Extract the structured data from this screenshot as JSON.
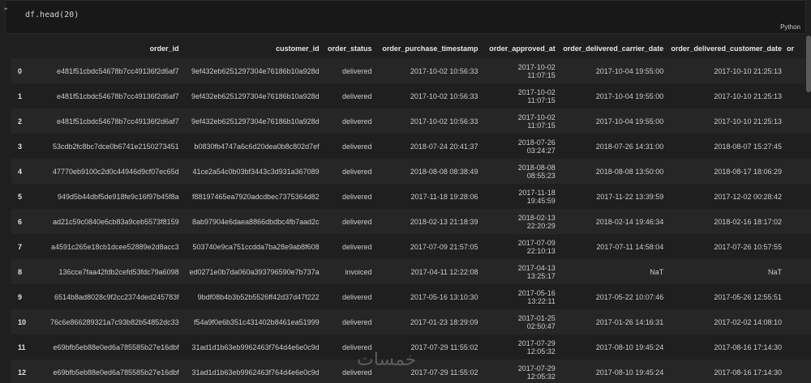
{
  "cell": {
    "code": "df.head(20)",
    "language": "Python",
    "chevron": "⌄"
  },
  "table": {
    "columns": [
      "order_id",
      "customer_id",
      "order_status",
      "order_purchase_timestamp",
      "order_approved_at",
      "order_delivered_carrier_date",
      "order_delivered_customer_date",
      "or"
    ],
    "rows": [
      {
        "idx": "0",
        "order_id": "e481f51cbdc54678b7cc49136f2d6af7",
        "customer_id": "9ef432eb6251297304e76186b10a928d",
        "status": "delivered",
        "purchase": "2017-10-02 10:56:33",
        "approved_date": "2017-10-02",
        "approved_time": "11:07:15",
        "carrier": "2017-10-04 19:55:00",
        "customer": "2017-10-10 21:25:13"
      },
      {
        "idx": "1",
        "order_id": "e481f51cbdc54678b7cc49136f2d6af7",
        "customer_id": "9ef432eb6251297304e76186b10a928d",
        "status": "delivered",
        "purchase": "2017-10-02 10:56:33",
        "approved_date": "2017-10-02",
        "approved_time": "11:07:15",
        "carrier": "2017-10-04 19:55:00",
        "customer": "2017-10-10 21:25:13"
      },
      {
        "idx": "2",
        "order_id": "e481f51cbdc54678b7cc49136f2d6af7",
        "customer_id": "9ef432eb6251297304e76186b10a928d",
        "status": "delivered",
        "purchase": "2017-10-02 10:56:33",
        "approved_date": "2017-10-02",
        "approved_time": "11:07:15",
        "carrier": "2017-10-04 19:55:00",
        "customer": "2017-10-10 21:25:13"
      },
      {
        "idx": "3",
        "order_id": "53cdb2fc8bc7dce0b6741e2150273451",
        "customer_id": "b0830fb4747a6c6d20dea0b8c802d7ef",
        "status": "delivered",
        "purchase": "2018-07-24 20:41:37",
        "approved_date": "2018-07-26",
        "approved_time": "03:24:27",
        "carrier": "2018-07-26 14:31:00",
        "customer": "2018-08-07 15:27:45"
      },
      {
        "idx": "4",
        "order_id": "47770eb9100c2d0c44946d9cf07ec65d",
        "customer_id": "41ce2a54c0b03bf3443c3d931a367089",
        "status": "delivered",
        "purchase": "2018-08-08 08:38:49",
        "approved_date": "2018-08-08",
        "approved_time": "08:55:23",
        "carrier": "2018-08-08 13:50:00",
        "customer": "2018-08-17 18:06:29"
      },
      {
        "idx": "5",
        "order_id": "949d5b44dbf5de918fe9c16f97b45f8a",
        "customer_id": "f88197465ea7920adcdbec7375364d82",
        "status": "delivered",
        "purchase": "2017-11-18 19:28:06",
        "approved_date": "2017-11-18",
        "approved_time": "19:45:59",
        "carrier": "2017-11-22 13:39:59",
        "customer": "2017-12-02 00:28:42"
      },
      {
        "idx": "6",
        "order_id": "ad21c59c0840e6cb83a9ceb5573f8159",
        "customer_id": "8ab97904e6daea8866dbdbc4fb7aad2c",
        "status": "delivered",
        "purchase": "2018-02-13 21:18:39",
        "approved_date": "2018-02-13",
        "approved_time": "22:20:29",
        "carrier": "2018-02-14 19:46:34",
        "customer": "2018-02-16 18:17:02"
      },
      {
        "idx": "7",
        "order_id": "a4591c265e18cb1dcee52889e2d8acc3",
        "customer_id": "503740e9ca751ccdda7ba28e9ab8f608",
        "status": "delivered",
        "purchase": "2017-07-09 21:57:05",
        "approved_date": "2017-07-09",
        "approved_time": "22:10:13",
        "carrier": "2017-07-11 14:58:04",
        "customer": "2017-07-26 10:57:55"
      },
      {
        "idx": "8",
        "order_id": "136cce7faa42fdb2cefd53fdc79a6098",
        "customer_id": "ed0271e0b7da060a393796590e7b737a",
        "status": "invoiced",
        "purchase": "2017-04-11 12:22:08",
        "approved_date": "2017-04-13",
        "approved_time": "13:25:17",
        "carrier": "NaT",
        "customer": "NaT"
      },
      {
        "idx": "9",
        "order_id": "6514b8ad8028c9f2cc2374ded245783f",
        "customer_id": "9bdf08b4b3b52b5526ff42d37d47f222",
        "status": "delivered",
        "purchase": "2017-05-16 13:10:30",
        "approved_date": "2017-05-16",
        "approved_time": "13:22:11",
        "carrier": "2017-05-22 10:07:46",
        "customer": "2017-05-26 12:55:51"
      },
      {
        "idx": "10",
        "order_id": "76c6e866289321a7c93b82b54852dc33",
        "customer_id": "f54a9f0e6b351c431402b8461ea51999",
        "status": "delivered",
        "purchase": "2017-01-23 18:29:09",
        "approved_date": "2017-01-25",
        "approved_time": "02:50:47",
        "carrier": "2017-01-26 14:16:31",
        "customer": "2017-02-02 14:08:10"
      },
      {
        "idx": "11",
        "order_id": "e69bfb5eb88e0ed6a785585b27e16dbf",
        "customer_id": "31ad1d1b63eb9962463f764d4e6e0c9d",
        "status": "delivered",
        "purchase": "2017-07-29 11:55:02",
        "approved_date": "2017-07-29",
        "approved_time": "12:05:32",
        "carrier": "2017-08-10 19:45:24",
        "customer": "2017-08-16 17:14:30"
      },
      {
        "idx": "12",
        "order_id": "e69bfb5eb88e0ed6a785585b27e16dbf",
        "customer_id": "31ad1d1b63eb9962463f764d4e6e0c9d",
        "status": "delivered",
        "purchase": "2017-07-29 11:55:02",
        "approved_date": "2017-07-29",
        "approved_time": "12:05:32",
        "carrier": "2017-08-10 19:45:24",
        "customer": "2017-08-16 17:14:30"
      }
    ]
  },
  "watermark": "خمسات"
}
